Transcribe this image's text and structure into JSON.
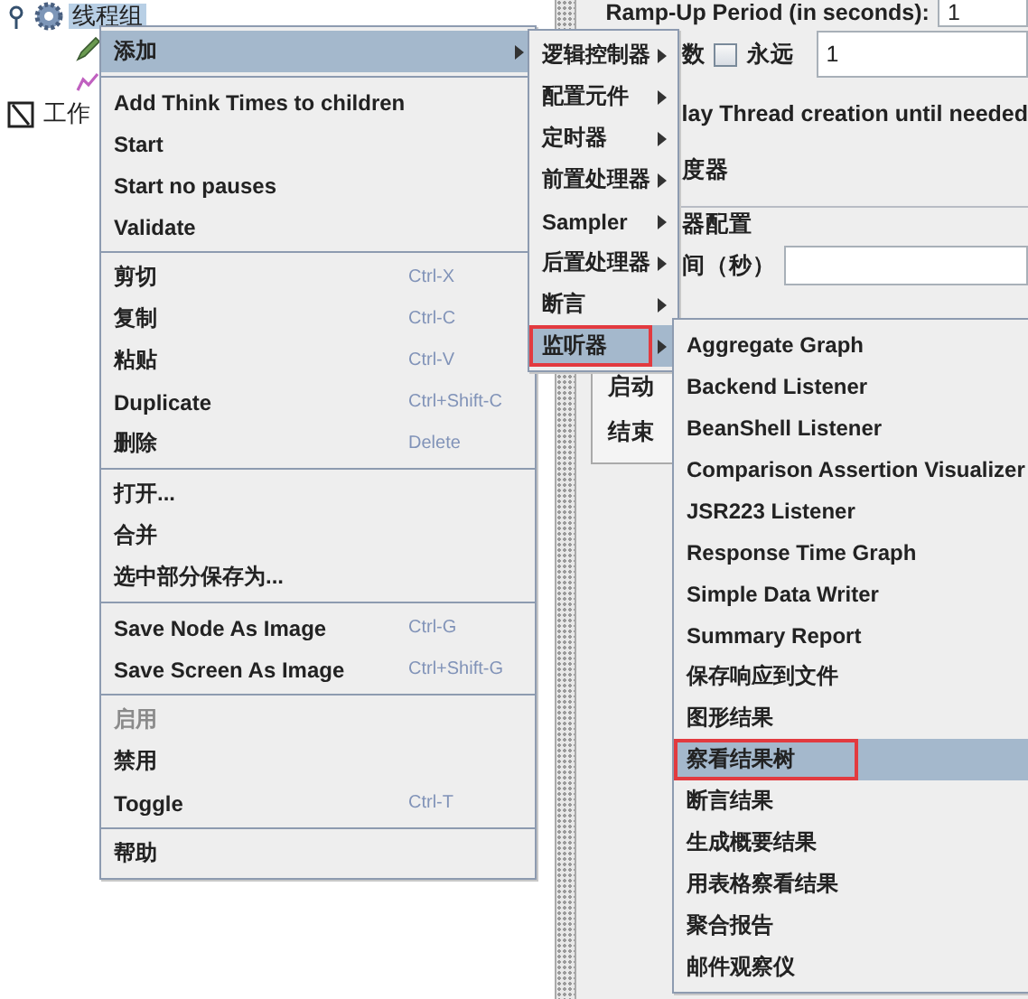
{
  "tree": {
    "root": {
      "label": "线程组",
      "selected": true
    },
    "workbench": {
      "label": "工作"
    }
  },
  "form": {
    "ramp_up_label": "Ramp-Up Period (in seconds):",
    "ramp_up_value": "1",
    "loop_label": "数",
    "forever": {
      "label": "永远",
      "checked": false
    },
    "loop_value": "1",
    "delay_text": "lay Thread creation until needed",
    "scheduler_text": "度器",
    "group_title": "器配置",
    "duration_label": "间（秒）",
    "start_label": "启动",
    "end_label": "结束"
  },
  "context_menu": {
    "groups": [
      [
        {
          "label": "添加",
          "submenu": true,
          "selected": true,
          "disabled": false
        }
      ],
      [
        {
          "label": "Add Think Times to children",
          "selected": false,
          "disabled": false
        },
        {
          "label": "Start",
          "selected": false,
          "disabled": false
        },
        {
          "label": "Start no pauses",
          "selected": false,
          "disabled": false
        },
        {
          "label": "Validate",
          "selected": false,
          "disabled": false
        }
      ],
      [
        {
          "label": "剪切",
          "shortcut": "Ctrl-X",
          "selected": false,
          "disabled": false
        },
        {
          "label": "复制",
          "shortcut": "Ctrl-C",
          "selected": false,
          "disabled": false
        },
        {
          "label": "粘贴",
          "shortcut": "Ctrl-V",
          "selected": false,
          "disabled": false
        },
        {
          "label": "Duplicate",
          "shortcut": "Ctrl+Shift-C",
          "selected": false,
          "disabled": false
        },
        {
          "label": "删除",
          "shortcut": "Delete",
          "selected": false,
          "disabled": false
        }
      ],
      [
        {
          "label": "打开...",
          "selected": false,
          "disabled": false
        },
        {
          "label": "合并",
          "selected": false,
          "disabled": false
        },
        {
          "label": "选中部分保存为...",
          "selected": false,
          "disabled": false
        }
      ],
      [
        {
          "label": "Save Node As Image",
          "shortcut": "Ctrl-G",
          "selected": false,
          "disabled": false
        },
        {
          "label": "Save Screen As Image",
          "shortcut": "Ctrl+Shift-G",
          "selected": false,
          "disabled": false
        }
      ],
      [
        {
          "label": "启用",
          "selected": false,
          "disabled": true
        },
        {
          "label": "禁用",
          "selected": false,
          "disabled": false
        },
        {
          "label": "Toggle",
          "shortcut": "Ctrl-T",
          "selected": false,
          "disabled": false
        }
      ],
      [
        {
          "label": "帮助",
          "selected": false,
          "disabled": false
        }
      ]
    ]
  },
  "add_submenu": {
    "items": [
      {
        "label": "逻辑控制器",
        "selected": false,
        "outlined": false
      },
      {
        "label": "配置元件",
        "selected": false,
        "outlined": false
      },
      {
        "label": "定时器",
        "selected": false,
        "outlined": false
      },
      {
        "label": "前置处理器",
        "selected": false,
        "outlined": false
      },
      {
        "label": "Sampler",
        "selected": false,
        "outlined": false
      },
      {
        "label": "后置处理器",
        "selected": false,
        "outlined": false
      },
      {
        "label": "断言",
        "selected": false,
        "outlined": false
      },
      {
        "label": "监听器",
        "selected": true,
        "outlined": true
      }
    ]
  },
  "listener_submenu": {
    "items": [
      {
        "label": "Aggregate Graph",
        "selected": false,
        "outlined": false
      },
      {
        "label": "Backend Listener",
        "selected": false,
        "outlined": false
      },
      {
        "label": "BeanShell Listener",
        "selected": false,
        "outlined": false
      },
      {
        "label": "Comparison Assertion Visualizer",
        "selected": false,
        "outlined": false
      },
      {
        "label": "JSR223 Listener",
        "selected": false,
        "outlined": false
      },
      {
        "label": "Response Time Graph",
        "selected": false,
        "outlined": false
      },
      {
        "label": "Simple Data Writer",
        "selected": false,
        "outlined": false
      },
      {
        "label": "Summary Report",
        "selected": false,
        "outlined": false
      },
      {
        "label": "保存响应到文件",
        "selected": false,
        "outlined": false
      },
      {
        "label": "图形结果",
        "selected": false,
        "outlined": false
      },
      {
        "label": "察看结果树",
        "selected": true,
        "outlined": true
      },
      {
        "label": "断言结果",
        "selected": false,
        "outlined": false
      },
      {
        "label": "生成概要结果",
        "selected": false,
        "outlined": false
      },
      {
        "label": "用表格察看结果",
        "selected": false,
        "outlined": false
      },
      {
        "label": "聚合报告",
        "selected": false,
        "outlined": false
      },
      {
        "label": "邮件观察仪",
        "selected": false,
        "outlined": false
      }
    ]
  }
}
